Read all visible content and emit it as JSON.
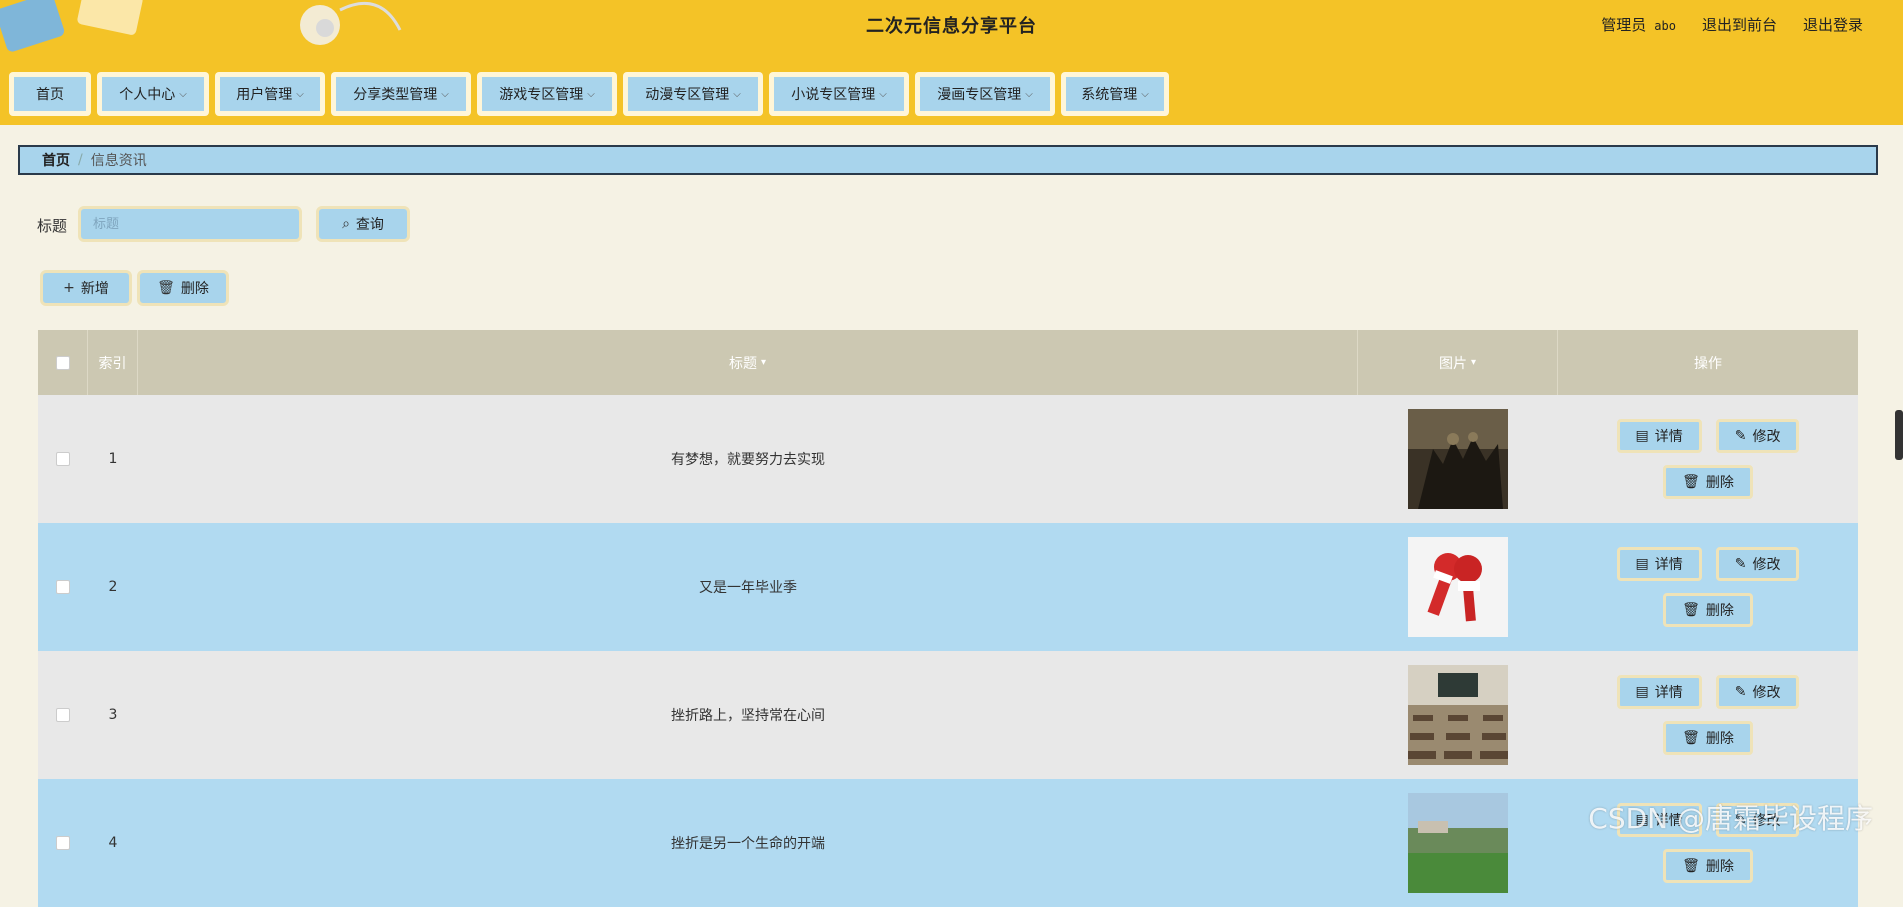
{
  "header": {
    "site_title": "二次元信息分享平台",
    "role": "管理员",
    "username": "abo",
    "to_front": "退出到前台",
    "logout": "退出登录"
  },
  "nav": [
    {
      "label": "首页"
    },
    {
      "label": "个人中心"
    },
    {
      "label": "用户管理"
    },
    {
      "label": "分享类型管理"
    },
    {
      "label": "游戏专区管理"
    },
    {
      "label": "动漫专区管理"
    },
    {
      "label": "小说专区管理"
    },
    {
      "label": "漫画专区管理"
    },
    {
      "label": "系统管理"
    }
  ],
  "breadcrumb": {
    "home": "首页",
    "separator": "/",
    "current": "信息资讯"
  },
  "search": {
    "label": "标题",
    "placeholder": "标题",
    "button": "查询"
  },
  "toolbar": {
    "add": "新增",
    "delete": "删除"
  },
  "table": {
    "columns": {
      "index": "索引",
      "title": "标题",
      "image": "图片",
      "ops": "操作"
    },
    "rows": [
      {
        "index": "1",
        "title": "有梦想，就要努力去实现",
        "image": "dark-crowd-thumbnail"
      },
      {
        "index": "2",
        "title": "又是一年毕业季",
        "image": "live-microphone-thumbnail"
      },
      {
        "index": "3",
        "title": "挫折路上，坚持常在心间",
        "image": "classroom-thumbnail"
      },
      {
        "index": "4",
        "title": "挫折是另一个生命的开端",
        "image": "campus-field-thumbnail"
      }
    ],
    "ops": {
      "detail": "详情",
      "edit": "修改",
      "delete": "删除"
    }
  },
  "watermark": "CSDN @唐霜毕设程序",
  "colors": {
    "header_bg": "#f4c327",
    "accent_blue": "#a8d4ec",
    "row_blue": "#b1daf1",
    "page_bg": "#f5f2e4"
  }
}
